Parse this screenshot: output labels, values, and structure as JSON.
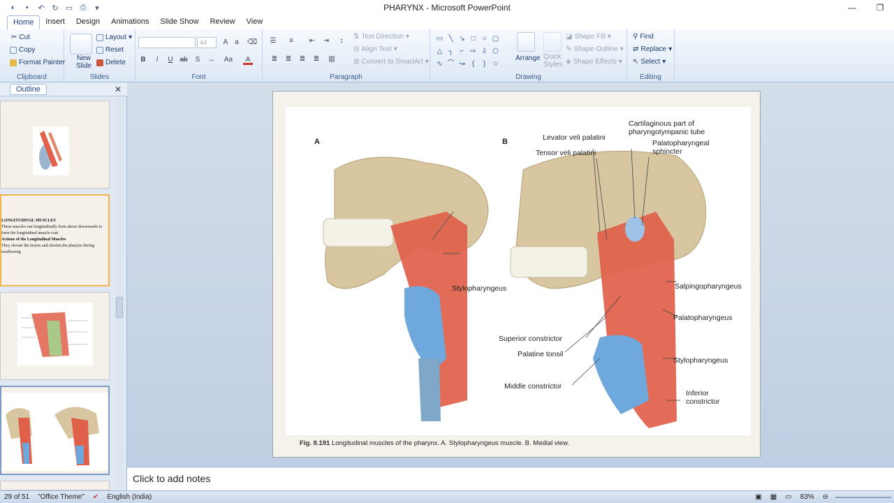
{
  "app": {
    "title": "PHARYNX - Microsoft PowerPoint"
  },
  "colors": {
    "ribbon_text": "#15428b",
    "accent": "#f3b34c",
    "muscle": "#e0604a",
    "cartilage": "#6fa8dc",
    "bone": "#d8c6a0"
  },
  "tabs": [
    {
      "label": "Home",
      "active": true
    },
    {
      "label": "Insert"
    },
    {
      "label": "Design"
    },
    {
      "label": "Animations"
    },
    {
      "label": "Slide Show"
    },
    {
      "label": "Review"
    },
    {
      "label": "View"
    }
  ],
  "ribbon": {
    "clipboard": {
      "label": "Clipboard",
      "cut": "Cut",
      "copy": "Copy",
      "format_painter": "Format Painter"
    },
    "slides": {
      "label": "Slides",
      "new_slide": "New Slide",
      "layout": "Layout",
      "reset": "Reset",
      "delete": "Delete"
    },
    "font": {
      "label": "Font",
      "size": "44"
    },
    "paragraph": {
      "label": "Paragraph",
      "text_direction": "Text Direction",
      "align_text": "Align Text",
      "convert_smartart": "Convert to SmartArt"
    },
    "drawing": {
      "label": "Drawing",
      "arrange": "Arrange",
      "quick_styles": "Quick Styles",
      "shape_fill": "Shape Fill",
      "shape_outline": "Shape Outline",
      "shape_effects": "Shape Effects"
    },
    "editing": {
      "label": "Editing",
      "find": "Find",
      "replace": "Replace",
      "select": "Select"
    }
  },
  "panel": {
    "outline_tab": "Outline"
  },
  "thumbnails": {
    "slide2": {
      "title": "LONGITUDINAL MUSCLES",
      "line1": "These muscles run longitudinally from above downwards to form the longitudinal muscle coat",
      "heading2": "Actions of the Longitudinal Muscles",
      "line2": "They elevate the larynx and shorten the pharynx during swallowing"
    }
  },
  "slide": {
    "panel_a": "A",
    "panel_b": "B",
    "labels": {
      "stylopharyngeus_a": "Stylopharyngeus",
      "levator": "Levator veli palatini",
      "tensor": "Tensor veli palatini",
      "cartilaginous_1": "Cartilaginous part of",
      "cartilaginous_2": "pharyngotympanic tube",
      "palatopharyngeal_1": "Palatopharyngeal",
      "palatopharyngeal_2": "sphincter",
      "salpingo": "Salpingopharyngeus",
      "palatopharyngeus": "Palatopharyngeus",
      "superior": "Superior constrictor",
      "palatine": "Palatine tonsil",
      "stylopharyngeus_b": "Stylopharyngeus",
      "middle": "Middle constrictor",
      "inferior_1": "Inferior",
      "inferior_2": "constrictor"
    },
    "caption_fig": "Fig. 8.191",
    "caption_text": "Longitudinal muscles of the pharynx. A. Stylopharyngeus muscle. B. Medial view."
  },
  "notes": {
    "placeholder": "Click to add notes"
  },
  "status": {
    "slide_info": "29 of 51",
    "theme": "\"Office Theme\"",
    "language": "English (India)",
    "zoom": "83%"
  }
}
